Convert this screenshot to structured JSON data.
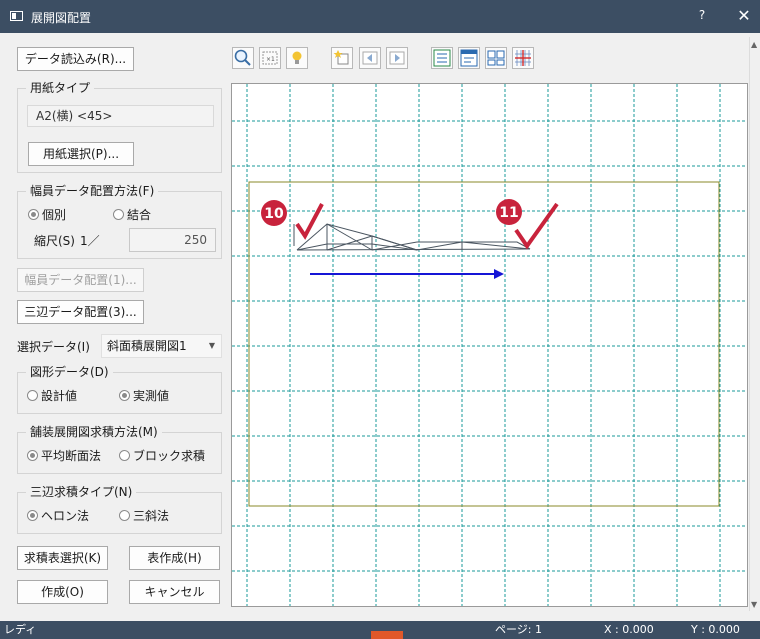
{
  "title": "展開図配置",
  "titlebar": {
    "help": "?",
    "close": "✕"
  },
  "left": {
    "data_read_button": "データ読込み(R)...",
    "paper_type": {
      "title": "用紙タイプ",
      "value": "A2(横) <45>",
      "select_button": "用紙選択(P)..."
    },
    "width_layout": {
      "title": "幅員データ配置方法(F)",
      "option_individual": "個別",
      "option_combined": "結合",
      "scale_label": "縮尺(S)",
      "scale_prefix": "1／",
      "scale_value": "250"
    },
    "width_place_button": "幅員データ配置(1)...",
    "tri_place_button": "三辺データ配置(3)...",
    "select_data": {
      "label": "選択データ(I)",
      "value": "斜面積展開図1"
    },
    "figure_data": {
      "title": "図形データ(D)",
      "option_design": "設計値",
      "option_measured": "実測値"
    },
    "pavement_method": {
      "title": "舗装展開図求積方法(M)",
      "option_avg": "平均断面法",
      "option_block": "ブロック求積"
    },
    "tri_area_type": {
      "title": "三辺求積タイプ(N)",
      "option_heron": "ヘロン法",
      "option_three": "三斜法"
    },
    "table_select_button": "求積表選択(K)",
    "table_create_button": "表作成(H)",
    "create_button": "作成(O)",
    "cancel_button": "キャンセル"
  },
  "markers": {
    "first": "10",
    "second": "11"
  },
  "colors": {
    "titlebar": "#3c4e63",
    "grid": "#1a9a9a",
    "frame": "#8a8a2a",
    "marker": "#c8233c",
    "arrow": "#1515d6"
  },
  "status": {
    "left": "レディ",
    "page": "ページ: 1",
    "x": "X : 0.000",
    "y": "Y : 0.000"
  }
}
